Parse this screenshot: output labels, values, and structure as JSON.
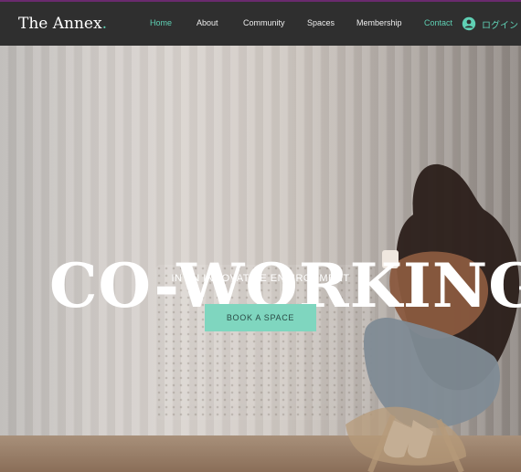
{
  "brand": {
    "name": "The Annex",
    "dot": "."
  },
  "nav": {
    "items": [
      {
        "label": "Home",
        "active": true
      },
      {
        "label": "About",
        "active": false
      },
      {
        "label": "Community",
        "active": false
      },
      {
        "label": "Spaces",
        "active": false
      },
      {
        "label": "Membership",
        "active": false
      },
      {
        "label": "Contact",
        "active": true
      }
    ],
    "login_label": "ログイン",
    "login_icon": "user-icon"
  },
  "hero": {
    "headline": "CO-WORKING",
    "subtitle": "IN AN INNOVATIVE ENVIRONMENT",
    "cta_label": "BOOK A SPACE"
  },
  "colors": {
    "accent": "#5fd0b4",
    "button": "#7fd6bf",
    "nav_bg": "#2f2f2f"
  }
}
